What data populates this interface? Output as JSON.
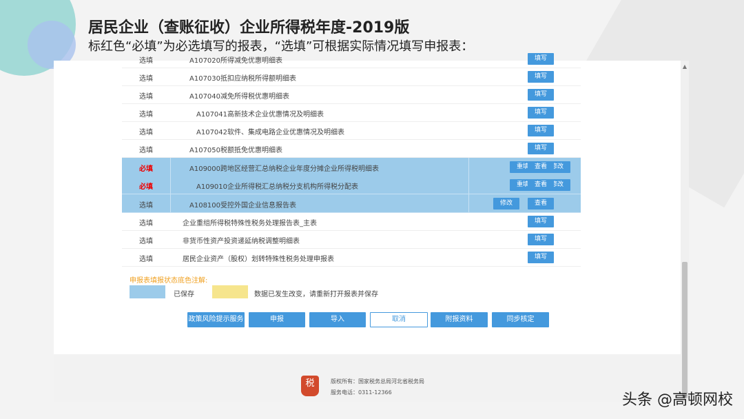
{
  "slide": {
    "title": "居民企业（查账征收）企业所得税年度-2019版",
    "subtitle": "标红色“必填”为必选填写的报表，“选填”可根据实际情况填写申报表："
  },
  "rows": [
    {
      "status": "选填",
      "required": false,
      "name": "A107020所得减免优惠明细表",
      "buttons": [
        "填写"
      ]
    },
    {
      "status": "选填",
      "required": false,
      "name": "A107030抵扣应纳税所得额明细表",
      "buttons": [
        "填写"
      ]
    },
    {
      "status": "选填",
      "required": false,
      "name": "A107040减免所得税优惠明细表",
      "buttons": [
        "填写"
      ]
    },
    {
      "status": "选填",
      "required": false,
      "name": "A107041高新技术企业优惠情况及明细表",
      "buttons": [
        "填写"
      ]
    },
    {
      "status": "选填",
      "required": false,
      "name": "A107042软件、集成电路企业优惠情况及明细表",
      "buttons": [
        "填写"
      ]
    },
    {
      "status": "选填",
      "required": false,
      "name": "A107050税额抵免优惠明细表",
      "buttons": [
        "填写"
      ]
    },
    {
      "status": "必填",
      "required": true,
      "name": "A109000跨地区经营汇总纳税企业年度分摊企业所得税明细表",
      "buttons": [
        "重填",
        "修改",
        "查看"
      ]
    },
    {
      "status": "必填",
      "required": true,
      "name": "A109010企业所得税汇总纳税分支机构所得税分配表",
      "buttons": [
        "重填",
        "修改",
        "查看"
      ]
    },
    {
      "status": "选填",
      "required": false,
      "name": "A108100受控外国企业信息报告表",
      "buttons": [
        "修改",
        "查看"
      ]
    },
    {
      "status": "选填",
      "required": false,
      "name": "企业重组所得税特殊性税务处理报告表_主表",
      "buttons": [
        "填写"
      ]
    },
    {
      "status": "选填",
      "required": false,
      "name": "非货币性资产投资递延纳税调整明细表",
      "buttons": [
        "填写"
      ]
    },
    {
      "status": "选填",
      "required": false,
      "name": "居民企业资产（股权）划转特殊性税务处理申报表",
      "buttons": [
        "填写"
      ]
    }
  ],
  "legend": {
    "title": "申报表填报状态底色注解:",
    "saved": "已保存",
    "changed": "数据已发生改变，请重新打开报表并保存",
    "saved_color": "#9ccbea",
    "changed_color": "#f6e58d"
  },
  "actions": {
    "policy": "政策风险提示服务",
    "declare": "申报",
    "import": "导入",
    "cancel": "取消",
    "attachment": "附报资料",
    "sync": "同步核定"
  },
  "footer": {
    "icon_text": "税",
    "copyright": "版权所有：国家税务总局河北省税务局",
    "phone": "服务电话：0311-12366"
  },
  "watermark": "头条 @高顿网校",
  "colors": {
    "accent": "#4499dd",
    "required": "#e00000",
    "highlight": "#9ccbea"
  },
  "icons": {
    "scroll_up": "triangle-up-icon",
    "scroll_down": "triangle-down-icon"
  }
}
